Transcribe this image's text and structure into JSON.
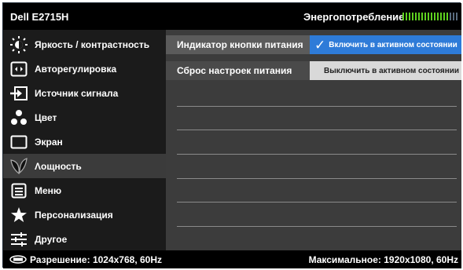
{
  "header": {
    "brand": "Dell E2715H",
    "energy_label": "Энергопотребление",
    "energy_level": 0.85
  },
  "sidebar": {
    "items": [
      {
        "name": "brightness",
        "label": "Яркость / контрастность",
        "icon": "brightness-icon"
      },
      {
        "name": "auto-adjust",
        "label": "Авторегулировка",
        "icon": "auto-adjust-icon"
      },
      {
        "name": "input-source",
        "label": "Источник сигнала",
        "icon": "input-source-icon"
      },
      {
        "name": "color",
        "label": "Цвет",
        "icon": "color-icon"
      },
      {
        "name": "display",
        "label": "Экран",
        "icon": "display-icon"
      },
      {
        "name": "power",
        "label": "Λощность",
        "icon": "power-leaf-icon",
        "active": true
      },
      {
        "name": "menu",
        "label": "Меню",
        "icon": "menu-icon"
      },
      {
        "name": "personalize",
        "label": "Персонализация",
        "icon": "star-icon"
      },
      {
        "name": "others",
        "label": "Другое",
        "icon": "sliders-icon"
      }
    ]
  },
  "main": {
    "rows": [
      {
        "label": "Индикатор кнопки питания",
        "option": "Включить в активном состоянии",
        "selected": true
      },
      {
        "label": "Сброс настроек питания",
        "option": "Выключить в активном состоянии",
        "selected": false
      }
    ]
  },
  "status": {
    "resolution": "Разрешение: 1024x768,  60Hz",
    "maximum": "Максимальное: 1920x1080,  60Hz"
  },
  "colors": {
    "accent": "#2e7bd8",
    "meter_on": "#5fd21f"
  }
}
